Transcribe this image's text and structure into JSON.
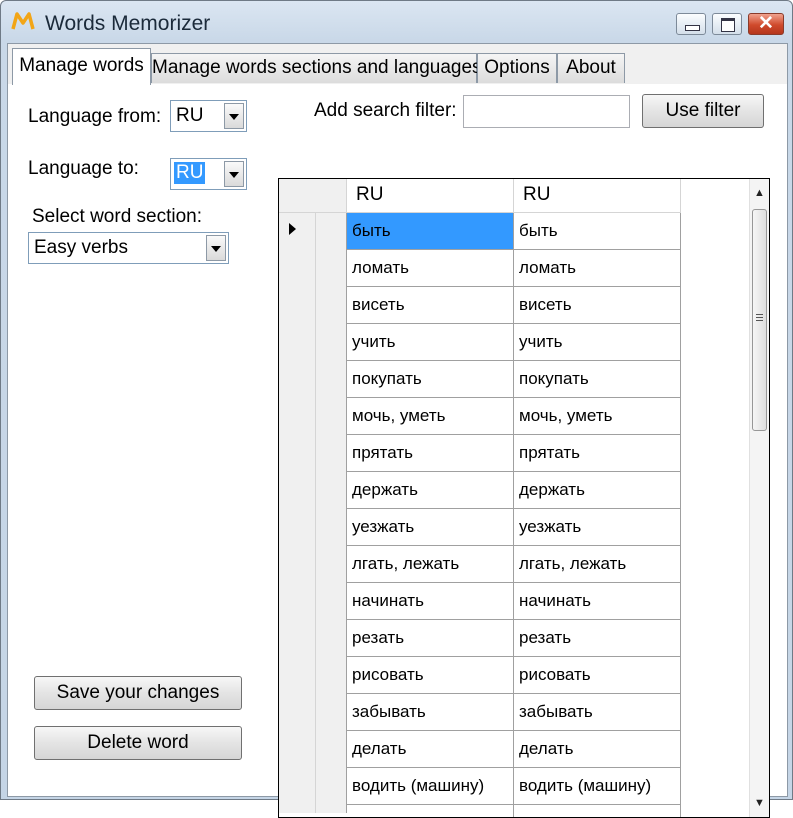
{
  "window": {
    "title": "Words Memorizer",
    "accent_color": "#c5d5e6",
    "close_glyph": "✕"
  },
  "tabs": [
    {
      "label": "Manage words",
      "active": true
    },
    {
      "label": "Manage words sections and languages",
      "active": false
    },
    {
      "label": "Options",
      "active": false
    },
    {
      "label": "About",
      "active": false
    }
  ],
  "left_panel": {
    "language_from_label": "Language from:",
    "language_from_value": "RU",
    "language_to_label": "Language to:",
    "language_to_value": "RU",
    "section_label": "Select word section:",
    "section_value": "Easy verbs",
    "save_button": "Save your changes",
    "delete_button": "Delete word"
  },
  "search": {
    "label": "Add search filter:",
    "value": "",
    "button": "Use filter"
  },
  "grid": {
    "columns": [
      "RU",
      "RU"
    ],
    "selected_row": 0,
    "rows": [
      [
        "быть",
        "быть"
      ],
      [
        "ломать",
        "ломать"
      ],
      [
        "висеть",
        "висеть"
      ],
      [
        "учить",
        "учить"
      ],
      [
        "покупать",
        "покупать"
      ],
      [
        "мочь, уметь",
        "мочь, уметь"
      ],
      [
        "прятать",
        "прятать"
      ],
      [
        "держать",
        "держать"
      ],
      [
        "уезжать",
        "уезжать"
      ],
      [
        "лгать, лежать",
        "лгать, лежать"
      ],
      [
        "начинать",
        "начинать"
      ],
      [
        "резать",
        "резать"
      ],
      [
        "рисовать",
        "рисовать"
      ],
      [
        "забывать",
        "забывать"
      ],
      [
        "делать",
        "делать"
      ],
      [
        "водить (машину)",
        "водить (машину)"
      ],
      [
        "",
        ""
      ]
    ]
  }
}
